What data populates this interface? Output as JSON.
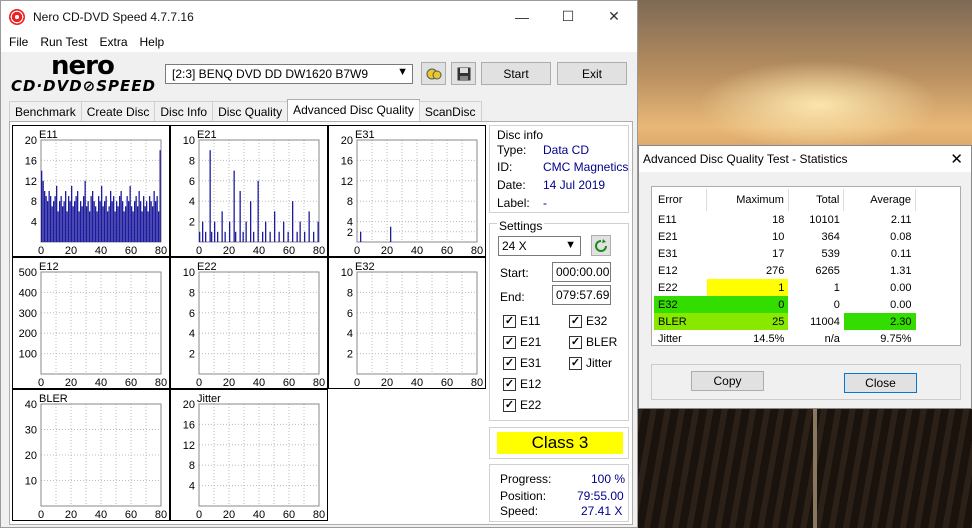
{
  "window": {
    "title": "Nero CD-DVD Speed 4.7.7.16",
    "controls": {
      "min": "—",
      "max": "☐",
      "close": "✕"
    }
  },
  "menu": [
    "File",
    "Run Test",
    "Extra",
    "Help"
  ],
  "logo": {
    "top": "nero",
    "bottom": "CD·DVD⊘SPEED"
  },
  "drive": {
    "value": "[2:3]   BENQ DVD DD DW1620 B7W9"
  },
  "toolbar": {
    "start": "Start",
    "exit": "Exit"
  },
  "tabs": [
    "Benchmark",
    "Create Disc",
    "Disc Info",
    "Disc Quality",
    "Advanced Disc Quality",
    "ScanDisc"
  ],
  "active_tab": "Advanced Disc Quality",
  "disc_info": {
    "header": "Disc info",
    "type_label": "Type:",
    "type": "Data CD",
    "id_label": "ID:",
    "id": "CMC Magnetics",
    "date_label": "Date:",
    "date": "14 Jul 2019",
    "label_label": "Label:",
    "label": "-"
  },
  "settings": {
    "header": "Settings",
    "speed": "24 X",
    "start_label": "Start:",
    "start": "000:00.00",
    "end_label": "End:",
    "end": "079:57.69",
    "checks": [
      {
        "label": "E11",
        "checked": true
      },
      {
        "label": "E32",
        "checked": true
      },
      {
        "label": "E21",
        "checked": true
      },
      {
        "label": "BLER",
        "checked": true
      },
      {
        "label": "E31",
        "checked": true
      },
      {
        "label": "Jitter",
        "checked": true
      },
      {
        "label": "E12",
        "checked": true
      },
      {
        "label": "E22",
        "checked": true
      }
    ]
  },
  "class_label": "Class 3",
  "progress": {
    "progress_label": "Progress:",
    "progress": "100 %",
    "position_label": "Position:",
    "position": "79:55.00",
    "speed_label": "Speed:",
    "speed": "27.41 X"
  },
  "chart_data": [
    {
      "type": "bar",
      "name": "E11",
      "xlim": [
        0,
        80
      ],
      "ylim": [
        0,
        20
      ],
      "yticks": [
        4,
        8,
        12,
        16,
        20
      ],
      "xticks": [
        0,
        20,
        40,
        60,
        80
      ],
      "color": "#1c1c9c",
      "values": [
        14,
        12,
        10,
        9,
        8,
        10,
        9,
        7,
        8,
        9,
        11,
        6,
        8,
        9,
        7,
        8,
        10,
        6,
        9,
        8,
        11,
        7,
        8,
        9,
        10,
        6,
        8,
        7,
        9,
        12,
        7,
        8,
        6,
        9,
        10,
        8,
        7,
        6,
        9,
        8,
        11,
        7,
        8,
        9,
        6,
        7,
        10,
        8,
        9,
        6,
        8,
        7,
        9,
        10,
        8,
        6,
        7,
        9,
        8,
        11,
        7,
        6,
        8,
        9,
        7,
        10,
        8,
        6,
        9,
        7,
        8,
        6,
        9,
        8,
        7,
        10,
        8,
        9,
        6,
        18
      ]
    },
    {
      "type": "bar",
      "name": "E21",
      "xlim": [
        0,
        80
      ],
      "ylim": [
        0,
        10
      ],
      "yticks": [
        2,
        4,
        6,
        8,
        10
      ],
      "xticks": [
        0,
        20,
        40,
        60,
        80
      ],
      "color": "#1c1c9c",
      "values": [
        1,
        0,
        2,
        0,
        1,
        0,
        0,
        9,
        1,
        0,
        2,
        0,
        1,
        0,
        0,
        3,
        0,
        1,
        0,
        0,
        2,
        0,
        0,
        7,
        1,
        0,
        0,
        5,
        0,
        1,
        0,
        2,
        0,
        0,
        4,
        0,
        1,
        0,
        0,
        6,
        0,
        0,
        1,
        0,
        2,
        0,
        0,
        1,
        0,
        0,
        3,
        0,
        0,
        1,
        0,
        0,
        2,
        0,
        0,
        1,
        0,
        0,
        4,
        0,
        0,
        1,
        0,
        2,
        0,
        0,
        1,
        0,
        0,
        3,
        0,
        0,
        1,
        0,
        0,
        2
      ]
    },
    {
      "type": "bar",
      "name": "E31",
      "xlim": [
        0,
        80
      ],
      "ylim": [
        0,
        20
      ],
      "yticks": [
        2,
        4,
        8,
        12,
        16,
        20
      ],
      "xticks": [
        0,
        20,
        40,
        60,
        80
      ],
      "color": "#1c1c9c",
      "values": [
        0,
        0,
        2,
        0,
        0,
        0,
        0,
        0,
        0,
        0,
        0,
        0,
        0,
        0,
        0,
        0,
        0,
        0,
        0,
        0,
        0,
        0,
        3,
        0,
        0,
        0,
        0,
        0,
        0,
        0,
        0,
        0,
        0,
        0,
        0,
        0,
        0,
        0,
        0,
        0,
        0,
        0,
        0,
        0,
        0,
        0,
        0,
        0,
        0,
        0,
        0,
        0,
        0,
        0,
        0,
        0,
        0,
        0,
        0,
        0,
        0,
        0,
        0,
        0,
        0,
        0,
        0,
        0,
        0,
        0,
        0,
        0,
        0,
        0,
        0,
        0,
        0,
        0,
        0,
        0
      ]
    },
    {
      "type": "bar",
      "name": "E12",
      "xlim": [
        0,
        80
      ],
      "ylim": [
        0,
        500
      ],
      "yticks": [
        100,
        200,
        300,
        400,
        500
      ],
      "xticks": [
        0,
        20,
        40,
        60,
        80
      ],
      "color": "#7a1a6a",
      "values": []
    },
    {
      "type": "bar",
      "name": "E22",
      "xlim": [
        0,
        80
      ],
      "ylim": [
        0,
        10
      ],
      "yticks": [
        2,
        4,
        6,
        8,
        10
      ],
      "xticks": [
        0,
        20,
        40,
        60,
        80
      ],
      "color": "#1c1c9c",
      "values": []
    },
    {
      "type": "bar",
      "name": "E32",
      "xlim": [
        0,
        80
      ],
      "ylim": [
        0,
        10
      ],
      "yticks": [
        2,
        4,
        6,
        8,
        10
      ],
      "xticks": [
        0,
        20,
        40,
        60,
        80
      ],
      "color": "#1c1c9c",
      "values": []
    },
    {
      "type": "bar",
      "name": "BLER",
      "xlim": [
        0,
        80
      ],
      "ylim": [
        0,
        40
      ],
      "yticks": [
        10,
        20,
        30,
        40
      ],
      "xticks": [
        0,
        20,
        40,
        60,
        80
      ],
      "color": "#1f7f1f",
      "values": []
    },
    {
      "type": "line",
      "name": "Jitter",
      "xlim": [
        0,
        80
      ],
      "ylim": [
        0,
        20
      ],
      "yticks": [
        4,
        8,
        12,
        16,
        20
      ],
      "xticks": [
        0,
        20,
        40,
        60,
        80
      ],
      "color": "#7a1030",
      "values": []
    }
  ],
  "stats": {
    "title": "Advanced Disc Quality Test - Statistics",
    "headers": [
      "Error",
      "Maximum",
      "Total",
      "Average"
    ],
    "rows": [
      {
        "error": "E11",
        "max": "18",
        "total": "10101",
        "avg": "2.11"
      },
      {
        "error": "E21",
        "max": "10",
        "total": "364",
        "avg": "0.08"
      },
      {
        "error": "E31",
        "max": "17",
        "total": "539",
        "avg": "0.11"
      },
      {
        "error": "E12",
        "max": "276",
        "total": "6265",
        "avg": "1.31"
      },
      {
        "error": "E22",
        "max": "1",
        "total": "1",
        "avg": "0.00"
      },
      {
        "error": "E32",
        "max": "0",
        "total": "0",
        "avg": "0.00"
      },
      {
        "error": "BLER",
        "max": "25",
        "total": "11004",
        "avg": "2.30"
      },
      {
        "error": "Jitter",
        "max": "14.5%",
        "total": "n/a",
        "avg": "9.75%"
      }
    ],
    "copy": "Copy",
    "close": "Close"
  }
}
